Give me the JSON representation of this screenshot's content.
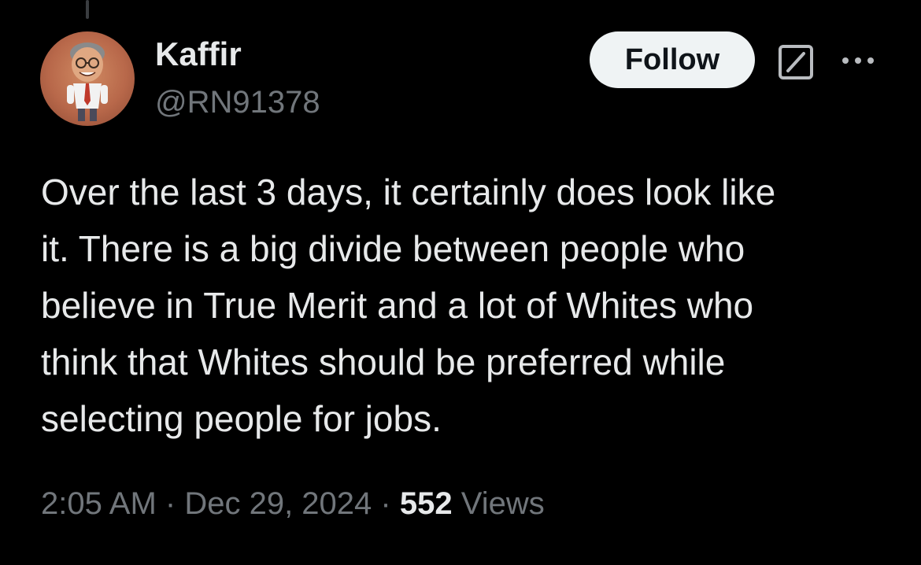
{
  "author": {
    "display_name": "Kaffir",
    "handle": "@RN91378"
  },
  "header": {
    "follow_label": "Follow",
    "grok_icon": "grok-icon",
    "more_icon": "more-icon"
  },
  "tweet": {
    "text": "Over the last 3 days, it certainly does look like\nit. There is a big divide between people who\nbelieve in True Merit and a lot of Whites who\nthink that Whites should be preferred while\nselecting people for jobs."
  },
  "meta": {
    "time": "2:05 AM",
    "separator": "·",
    "date": "Dec 29, 2024",
    "views_count": "552",
    "views_label": "Views"
  },
  "colors": {
    "background": "#000000",
    "primary_text": "#e7e9ea",
    "secondary_text": "#71767b",
    "follow_bg": "#eff3f4",
    "follow_text": "#0f1419"
  }
}
